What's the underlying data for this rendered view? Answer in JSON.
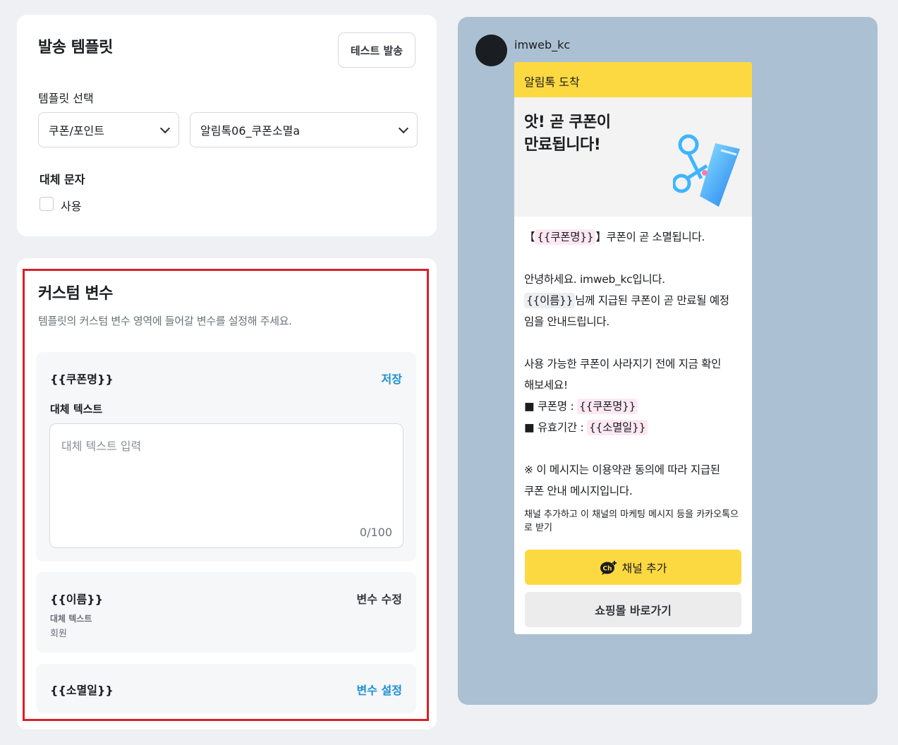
{
  "template_card": {
    "title": "발송 템플릿",
    "test_send_label": "테스트 발송",
    "template_select_label": "템플릿 선택",
    "category_value": "쿠폰/포인트",
    "template_value": "알림톡06_쿠폰소멸a",
    "fallback_heading": "대체 문자",
    "use_label": "사용"
  },
  "vars_card": {
    "title": "커스텀 변수",
    "description": "템플릿의 커스텀 변수 영역에 들어갈 변수를 설정해 주세요.",
    "var1": {
      "name": "{{쿠폰명}}",
      "action": "저장",
      "label": "대체 텍스트",
      "placeholder": "대체 텍스트 입력",
      "count": "0/100"
    },
    "var2": {
      "name": "{{이름}}",
      "action": "변수 수정",
      "label": "대체 텍스트",
      "value": "회원"
    },
    "var3": {
      "name": "{{소멸일}}",
      "action": "변수 설정"
    }
  },
  "preview": {
    "sender": "imweb_kc",
    "header": "알림톡 도착",
    "banner_line1": "앗! 곧 쿠폰이",
    "banner_line2": "만료됩니다!",
    "line1_pre": "【",
    "line1_var": "{{쿠폰명}}",
    "line1_post": "】쿠폰이 곧 소멸됩니다.",
    "line2": "안녕하세요. imweb_kc입니다.",
    "line3_var": "{{이름}}",
    "line3_post": "님께 지급된 쿠폰이 곧 만료될 예정",
    "line4": "임을 안내드립니다.",
    "line5": "사용 가능한 쿠폰이 사라지기 전에 지금 확인",
    "line6": "해보세요!",
    "line7_pre": "■ 쿠폰명 : ",
    "line7_var": "{{쿠폰명}}",
    "line8_pre": "■ 유효기간 : ",
    "line8_var": "{{소멸일}}",
    "line9": "※ 이 메시지는 이용약관 동의에 따라 지급된",
    "line10": "쿠폰 안내 메시지입니다.",
    "note": "채널 추가하고 이 채널의 마케팅 메시지 등을 카카오톡으로 받기",
    "channel_add_label": "채널 추가",
    "shop_label": "쇼핑몰 바로가기"
  },
  "colors": {
    "accent_blue": "#1a8fd6",
    "kakao_yellow": "#fdd941",
    "highlight_red": "#d92029",
    "preview_bg": "#abc0d2"
  }
}
